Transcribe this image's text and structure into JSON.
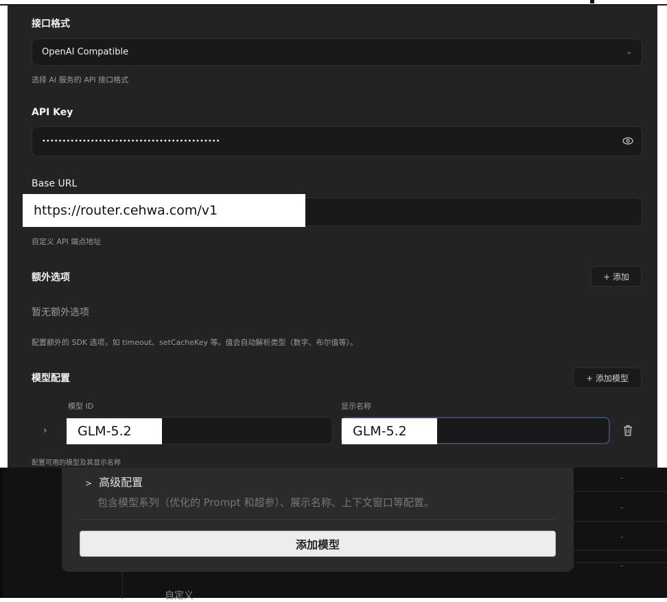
{
  "interface_format": {
    "label": "接口格式",
    "value": "OpenAI Compatible",
    "help": "选择 AI 服务的 API 接口格式"
  },
  "api_key": {
    "label": "API Key",
    "value": "••••••••••••••••••••••••••••••••••••••••••••"
  },
  "base_url": {
    "label": "Base URL",
    "value": "https://router.cehwa.com/v1",
    "help": "自定义 API 端点地址"
  },
  "extra_options": {
    "label": "额外选项",
    "add_label": "+ 添加",
    "empty_text": "暂无额外选项",
    "help": "配置额外的 SDK 选项，如 timeout、setCacheKey 等。值会自动解析类型（数字、布尔值等）。"
  },
  "model_config": {
    "label": "模型配置",
    "add_label": "+ 添加模型",
    "col_id": "模型 ID",
    "col_name": "显示名称",
    "rows": [
      {
        "id": "GLM-5.2",
        "name": "GLM-5.2"
      }
    ],
    "help": "配置可用的模型及其显示名称"
  },
  "advanced": {
    "title": "高级配置",
    "description": "包含模型系列（优化的 Prompt 和超参）、展示名称、上下文窗口等配置。",
    "button": "添加模型"
  },
  "background": {
    "dash": "-",
    "custom_label": "自定义"
  }
}
